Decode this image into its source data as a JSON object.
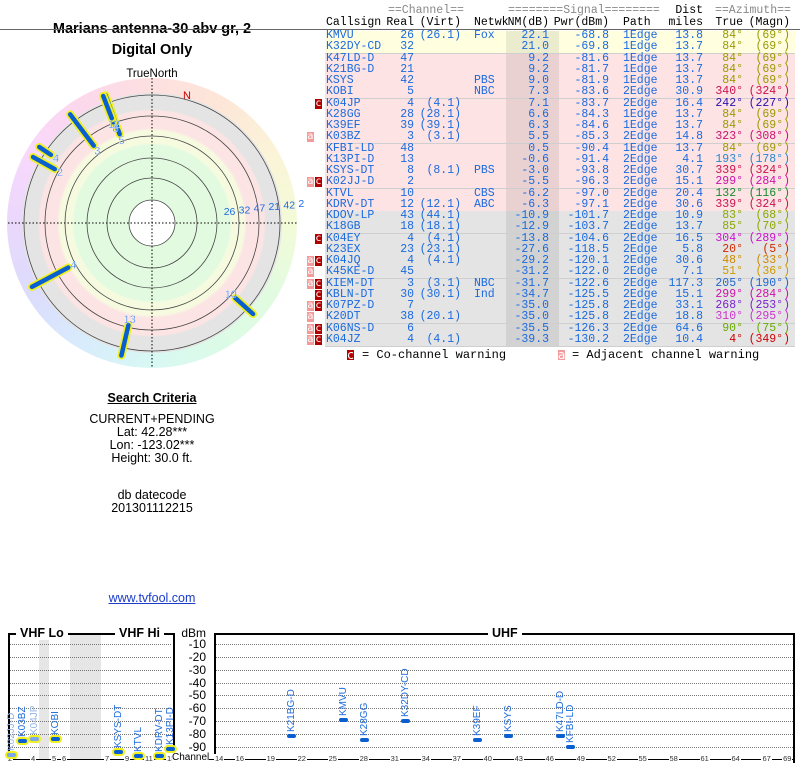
{
  "header": {
    "title": "Marians antenna-30 abv gr, 2",
    "subtitle": "Digital Only"
  },
  "radar": {
    "north_label": "TrueNorth",
    "n_marker": "N"
  },
  "search": {
    "heading": "Search Criteria",
    "mode": "CURRENT+PENDING",
    "lat": "Lat: 42.28***",
    "lon": "Lon: -123.02***",
    "height": "Height: 30.0 ft.",
    "db_label": "db datecode",
    "db_value": "201301112215",
    "link": "www.tvfool.com"
  },
  "table": {
    "group_headers": {
      "channel": "==Channel==",
      "signal": "========Signal========",
      "dist": "Dist",
      "azimuth": "==Azimuth=="
    },
    "columns": {
      "callsign": "Callsign",
      "real": "Real",
      "virt": "(Virt)",
      "netwk": "Netwk",
      "nm": "NM(dB)",
      "pwr": "Pwr(dBm)",
      "path": "Path",
      "miles": "miles",
      "true": "True",
      "magn": "(Magn)"
    },
    "colors": {
      "strong": "#ffffe0",
      "moderate": "#fde3e3",
      "weak": "#e4e4e4",
      "nm_shade": "rgba(0,0,0,0.08)",
      "text": "#1a6adf"
    },
    "rows": [
      {
        "callsign": "KMVU",
        "real": "26",
        "virt": "(26.1)",
        "netwk": "Fox",
        "nm": "22.1",
        "pwr": "-68.8",
        "path": "1Edge",
        "dist": "13.8",
        "true": "84°",
        "magn": "(69°)",
        "az_color": "#9a9a00",
        "warn": "",
        "band": "strong"
      },
      {
        "callsign": "K32DY-CD",
        "real": "32",
        "virt": "",
        "netwk": "",
        "nm": "21.0",
        "pwr": "-69.8",
        "path": "1Edge",
        "dist": "13.7",
        "true": "84°",
        "magn": "(69°)",
        "az_color": "#9a9a00",
        "warn": "",
        "band": "strong"
      },
      {
        "callsign": "K47LD-D",
        "real": "47",
        "virt": "",
        "netwk": "",
        "nm": "9.2",
        "pwr": "-81.6",
        "path": "1Edge",
        "dist": "13.7",
        "true": "84°",
        "magn": "(69°)",
        "az_color": "#9a9a00",
        "warn": "",
        "band": "moderate"
      },
      {
        "callsign": "K21BG-D",
        "real": "21",
        "virt": "",
        "netwk": "",
        "nm": "9.2",
        "pwr": "-81.7",
        "path": "1Edge",
        "dist": "13.7",
        "true": "84°",
        "magn": "(69°)",
        "az_color": "#9a9a00",
        "warn": "",
        "band": "moderate"
      },
      {
        "callsign": "KSYS",
        "real": "42",
        "virt": "",
        "netwk": "PBS",
        "nm": "9.0",
        "pwr": "-81.9",
        "path": "1Edge",
        "dist": "13.7",
        "true": "84°",
        "magn": "(69°)",
        "az_color": "#9a9a00",
        "warn": "",
        "band": "moderate"
      },
      {
        "callsign": "KOBI",
        "real": "5",
        "virt": "",
        "netwk": "NBC",
        "nm": "7.3",
        "pwr": "-83.6",
        "path": "2Edge",
        "dist": "30.9",
        "true": "340°",
        "magn": "(324°)",
        "az_color": "#cc1050",
        "warn": "",
        "band": "moderate"
      },
      {
        "callsign": "K04JP",
        "real": "4",
        "virt": "(4.1)",
        "netwk": "",
        "nm": "7.1",
        "pwr": "-83.7",
        "path": "2Edge",
        "dist": "16.4",
        "true": "242°",
        "magn": "(227°)",
        "az_color": "#2a10b0",
        "warn": "c",
        "band": "moderate"
      },
      {
        "callsign": "K28GG",
        "real": "28",
        "virt": "(28.1)",
        "netwk": "",
        "nm": "6.6",
        "pwr": "-84.3",
        "path": "1Edge",
        "dist": "13.7",
        "true": "84°",
        "magn": "(69°)",
        "az_color": "#9a9a00",
        "warn": "",
        "band": "moderate"
      },
      {
        "callsign": "K39EF",
        "real": "39",
        "virt": "(39.1)",
        "netwk": "",
        "nm": "6.3",
        "pwr": "-84.6",
        "path": "1Edge",
        "dist": "13.7",
        "true": "84°",
        "magn": "(69°)",
        "az_color": "#9a9a00",
        "warn": "",
        "band": "moderate"
      },
      {
        "callsign": "K03BZ",
        "real": "3",
        "virt": "(3.1)",
        "netwk": "",
        "nm": "5.5",
        "pwr": "-85.3",
        "path": "2Edge",
        "dist": "14.8",
        "true": "323°",
        "magn": "(308°)",
        "az_color": "#cc1070",
        "warn": "a",
        "band": "moderate"
      },
      {
        "callsign": "KFBI-LD",
        "real": "48",
        "virt": "",
        "netwk": "",
        "nm": "0.5",
        "pwr": "-90.4",
        "path": "1Edge",
        "dist": "13.7",
        "true": "84°",
        "magn": "(69°)",
        "az_color": "#9a9a00",
        "warn": "",
        "band": "moderate"
      },
      {
        "callsign": "K13PI-D",
        "real": "13",
        "virt": "",
        "netwk": "",
        "nm": "-0.6",
        "pwr": "-91.4",
        "path": "2Edge",
        "dist": "4.1",
        "true": "193°",
        "magn": "(178°)",
        "az_color": "#2a88cc",
        "warn": "",
        "band": "moderate"
      },
      {
        "callsign": "KSYS-DT",
        "real": "8",
        "virt": "(8.1)",
        "netwk": "PBS",
        "nm": "-3.0",
        "pwr": "-93.8",
        "path": "2Edge",
        "dist": "30.7",
        "true": "339°",
        "magn": "(324°)",
        "az_color": "#cc1050",
        "warn": "",
        "band": "moderate"
      },
      {
        "callsign": "K02JJ-D",
        "real": "2",
        "virt": "",
        "netwk": "",
        "nm": "-5.5",
        "pwr": "-96.3",
        "path": "2Edge",
        "dist": "15.1",
        "true": "299°",
        "magn": "(284°)",
        "az_color": "#cc10aa",
        "warn": "ac",
        "band": "moderate"
      },
      {
        "callsign": "KTVL",
        "real": "10",
        "virt": "",
        "netwk": "CBS",
        "nm": "-6.2",
        "pwr": "-97.0",
        "path": "2Edge",
        "dist": "20.4",
        "true": "132°",
        "magn": "(116°)",
        "az_color": "#1a8a30",
        "warn": "",
        "band": "moderate"
      },
      {
        "callsign": "KDRV-DT",
        "real": "12",
        "virt": "(12.1)",
        "netwk": "ABC",
        "nm": "-6.3",
        "pwr": "-97.1",
        "path": "2Edge",
        "dist": "30.6",
        "true": "339°",
        "magn": "(324°)",
        "az_color": "#cc1050",
        "warn": "",
        "band": "moderate"
      },
      {
        "callsign": "KDOV-LP",
        "real": "43",
        "virt": "(44.1)",
        "netwk": "",
        "nm": "-10.9",
        "pwr": "-101.7",
        "path": "2Edge",
        "dist": "10.9",
        "true": "83°",
        "magn": "(68°)",
        "az_color": "#8aa800",
        "warn": "",
        "band": "weak"
      },
      {
        "callsign": "K18GB",
        "real": "18",
        "virt": "(18.1)",
        "netwk": "",
        "nm": "-12.9",
        "pwr": "-103.7",
        "path": "2Edge",
        "dist": "13.7",
        "true": "85°",
        "magn": "(70°)",
        "az_color": "#8aa800",
        "warn": "",
        "band": "weak"
      },
      {
        "callsign": "K04EY",
        "real": "4",
        "virt": "(4.1)",
        "netwk": "",
        "nm": "-13.8",
        "pwr": "-104.6",
        "path": "2Edge",
        "dist": "16.5",
        "true": "304°",
        "magn": "(289°)",
        "az_color": "#cc10cc",
        "warn": "c",
        "band": "weak"
      },
      {
        "callsign": "K23EX",
        "real": "23",
        "virt": "(23.1)",
        "netwk": "",
        "nm": "-27.6",
        "pwr": "-118.5",
        "path": "2Edge",
        "dist": "5.8",
        "true": "20°",
        "magn": "(5°)",
        "az_color": "#cc2a00",
        "warn": "",
        "band": "weak"
      },
      {
        "callsign": "K04JQ",
        "real": "4",
        "virt": "(4.1)",
        "netwk": "",
        "nm": "-29.2",
        "pwr": "-120.1",
        "path": "2Edge",
        "dist": "30.6",
        "true": "48°",
        "magn": "(33°)",
        "az_color": "#cc8800",
        "warn": "ac",
        "band": "weak"
      },
      {
        "callsign": "K45KE-D",
        "real": "45",
        "virt": "",
        "netwk": "",
        "nm": "-31.2",
        "pwr": "-122.0",
        "path": "2Edge",
        "dist": "7.1",
        "true": "51°",
        "magn": "(36°)",
        "az_color": "#cc9a00",
        "warn": "a",
        "band": "weak"
      },
      {
        "callsign": "KIEM-DT",
        "real": "3",
        "virt": "(3.1)",
        "netwk": "NBC",
        "nm": "-31.7",
        "pwr": "-122.6",
        "path": "2Edge",
        "dist": "117.3",
        "true": "205°",
        "magn": "(190°)",
        "az_color": "#2266cc",
        "warn": "ac",
        "band": "weak"
      },
      {
        "callsign": "KBLN-DT",
        "real": "30",
        "virt": "(30.1)",
        "netwk": "Ind",
        "nm": "-34.7",
        "pwr": "-125.5",
        "path": "2Edge",
        "dist": "15.1",
        "true": "299°",
        "magn": "(284°)",
        "az_color": "#cc10aa",
        "warn": "c",
        "band": "weak"
      },
      {
        "callsign": "K07PZ-D",
        "real": "7",
        "virt": "",
        "netwk": "",
        "nm": "-35.0",
        "pwr": "-125.8",
        "path": "2Edge",
        "dist": "33.1",
        "true": "268°",
        "magn": "(253°)",
        "az_color": "#7a22cc",
        "warn": "ac",
        "band": "weak"
      },
      {
        "callsign": "K20DT",
        "real": "38",
        "virt": "(20.1)",
        "netwk": "",
        "nm": "-35.0",
        "pwr": "-125.8",
        "path": "2Edge",
        "dist": "18.8",
        "true": "310°",
        "magn": "(295°)",
        "az_color": "#cc33cc",
        "warn": "a",
        "band": "weak"
      },
      {
        "callsign": "K06NS-D",
        "real": "6",
        "virt": "",
        "netwk": "",
        "nm": "-35.5",
        "pwr": "-126.3",
        "path": "2Edge",
        "dist": "64.6",
        "true": "90°",
        "magn": "(75°)",
        "az_color": "#66aa00",
        "warn": "ac",
        "band": "weak"
      },
      {
        "callsign": "K04JZ",
        "real": "4",
        "virt": "(4.1)",
        "netwk": "",
        "nm": "-39.3",
        "pwr": "-130.2",
        "path": "2Edge",
        "dist": "10.4",
        "true": "4°",
        "magn": "(349°)",
        "az_color": "#cc0000",
        "warn": "ac",
        "band": "weak"
      }
    ],
    "legend": {
      "co_badge": "c",
      "co_text": "= Co-channel warning",
      "adj_badge": "a",
      "adj_text": "= Adjacent channel warning"
    }
  },
  "spectrum": {
    "vhf_lo": "VHF Lo",
    "vhf_hi": "VHF Hi",
    "uhf": "UHF",
    "unit": "dBm",
    "channel_label": "Channel",
    "dbm_ticks": [
      "-10",
      "-20",
      "-30",
      "-40",
      "-50",
      "-60",
      "-70",
      "-80",
      "-90"
    ],
    "vhf_ticks": [
      "2",
      "4",
      "5",
      "6",
      "7",
      "9",
      "11",
      "13"
    ],
    "uhf_ticks": [
      "14",
      "16",
      "19",
      "22",
      "25",
      "28",
      "31",
      "34",
      "37",
      "40",
      "43",
      "46",
      "49",
      "52",
      "55",
      "58",
      "61",
      "64",
      "67",
      "69"
    ],
    "faint_stations": [
      "K02JJ-D",
      "K04JP"
    ]
  }
}
